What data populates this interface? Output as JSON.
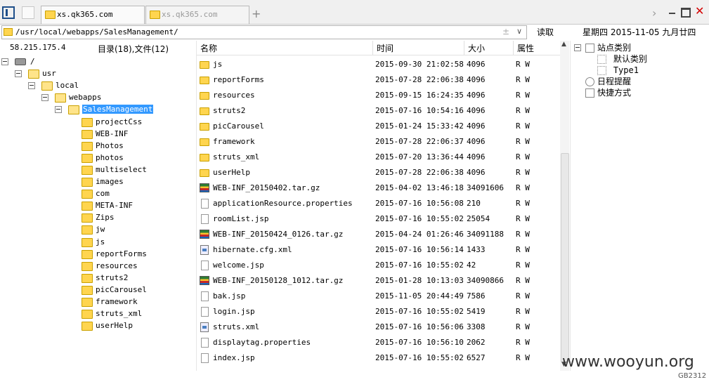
{
  "tabs": [
    {
      "label": "xs.qk365.com",
      "active": true
    },
    {
      "label": "xs.qk365.com",
      "active": false
    }
  ],
  "tab_add_label": "+",
  "path": {
    "value": "/usr/local/webapps/SalesManagement/",
    "read_button": "读取",
    "date_text": "星期四  2015-11-05  九月廿四"
  },
  "left": {
    "ip": "58.215.175.4",
    "count": "目录(18),文件(12)",
    "tree": [
      {
        "label": "/",
        "depth": 0,
        "expanded": true,
        "kind": "drive"
      },
      {
        "label": "usr",
        "depth": 1,
        "expanded": true
      },
      {
        "label": "local",
        "depth": 2,
        "expanded": true
      },
      {
        "label": "webapps",
        "depth": 3,
        "expanded": true
      },
      {
        "label": "SalesManagement",
        "depth": 4,
        "expanded": true,
        "selected": true
      },
      {
        "label": "projectCss",
        "depth": 5
      },
      {
        "label": "WEB-INF",
        "depth": 5
      },
      {
        "label": "Photos",
        "depth": 5
      },
      {
        "label": "photos",
        "depth": 5
      },
      {
        "label": "multiselect",
        "depth": 5
      },
      {
        "label": "images",
        "depth": 5
      },
      {
        "label": "com",
        "depth": 5
      },
      {
        "label": "META-INF",
        "depth": 5
      },
      {
        "label": "Zips",
        "depth": 5
      },
      {
        "label": "jw",
        "depth": 5
      },
      {
        "label": "js",
        "depth": 5
      },
      {
        "label": "reportForms",
        "depth": 5
      },
      {
        "label": "resources",
        "depth": 5
      },
      {
        "label": "struts2",
        "depth": 5
      },
      {
        "label": "picCarousel",
        "depth": 5
      },
      {
        "label": "framework",
        "depth": 5
      },
      {
        "label": "struts_xml",
        "depth": 5
      },
      {
        "label": "userHelp",
        "depth": 5
      }
    ]
  },
  "list": {
    "headers": {
      "name": "名称",
      "time": "时间",
      "size": "大小",
      "attr": "属性"
    },
    "rows": [
      {
        "name": "js",
        "time": "2015-09-30 21:02:58",
        "size": "4096",
        "attr": "R W",
        "icon": "folder"
      },
      {
        "name": "reportForms",
        "time": "2015-07-28 22:06:38",
        "size": "4096",
        "attr": "R W",
        "icon": "folder"
      },
      {
        "name": "resources",
        "time": "2015-09-15 16:24:35",
        "size": "4096",
        "attr": "R W",
        "icon": "folder"
      },
      {
        "name": "struts2",
        "time": "2015-07-16 10:54:16",
        "size": "4096",
        "attr": "R W",
        "icon": "folder"
      },
      {
        "name": "picCarousel",
        "time": "2015-01-24 15:33:42",
        "size": "4096",
        "attr": "R W",
        "icon": "folder"
      },
      {
        "name": "framework",
        "time": "2015-07-28 22:06:37",
        "size": "4096",
        "attr": "R W",
        "icon": "folder"
      },
      {
        "name": "struts_xml",
        "time": "2015-07-20 13:36:44",
        "size": "4096",
        "attr": "R W",
        "icon": "folder"
      },
      {
        "name": "userHelp",
        "time": "2015-07-28 22:06:38",
        "size": "4096",
        "attr": "R W",
        "icon": "folder"
      },
      {
        "name": "WEB-INF_20150402.tar.gz",
        "time": "2015-04-02 13:46:18",
        "size": "34091606",
        "attr": "R W",
        "icon": "archive"
      },
      {
        "name": "applicationResource.properties",
        "time": "2015-07-16 10:56:08",
        "size": "210",
        "attr": "R W",
        "icon": "file"
      },
      {
        "name": "roomList.jsp",
        "time": "2015-07-16 10:55:02",
        "size": "25054",
        "attr": "R W",
        "icon": "file"
      },
      {
        "name": "WEB-INF_20150424_0126.tar.gz",
        "time": "2015-04-24 01:26:46",
        "size": "34091188",
        "attr": "R W",
        "icon": "archive"
      },
      {
        "name": "hibernate.cfg.xml",
        "time": "2015-07-16 10:56:14",
        "size": "1433",
        "attr": "R W",
        "icon": "xml"
      },
      {
        "name": "welcome.jsp",
        "time": "2015-07-16 10:55:02",
        "size": "42",
        "attr": "R W",
        "icon": "file"
      },
      {
        "name": "WEB-INF_20150128_1012.tar.gz",
        "time": "2015-01-28 10:13:03",
        "size": "34090866",
        "attr": "R W",
        "icon": "archive"
      },
      {
        "name": "bak.jsp",
        "time": "2015-11-05 20:44:49",
        "size": "7586",
        "attr": "R W",
        "icon": "file"
      },
      {
        "name": "login.jsp",
        "time": "2015-07-16 10:55:02",
        "size": "5419",
        "attr": "R W",
        "icon": "file"
      },
      {
        "name": "struts.xml",
        "time": "2015-07-16 10:56:06",
        "size": "3308",
        "attr": "R W",
        "icon": "xml"
      },
      {
        "name": "displaytag.properties",
        "time": "2015-07-16 10:56:10",
        "size": "2062",
        "attr": "R W",
        "icon": "file"
      },
      {
        "name": "index.jsp",
        "time": "2015-07-16 10:55:02",
        "size": "6527",
        "attr": "R W",
        "icon": "file"
      }
    ]
  },
  "right": {
    "items": [
      {
        "label": "站点类别",
        "icon": "category-icon"
      },
      {
        "label": "默认类别",
        "icon": "dotted-box-icon"
      },
      {
        "label": "Type1",
        "icon": "dotted-box-icon"
      },
      {
        "label": "日程提醒",
        "icon": "clock-icon"
      },
      {
        "label": "快捷方式",
        "icon": "shortcut-icon"
      }
    ]
  },
  "footer": {
    "watermark": "www.wooyun.org",
    "encoding": "GB2312"
  }
}
